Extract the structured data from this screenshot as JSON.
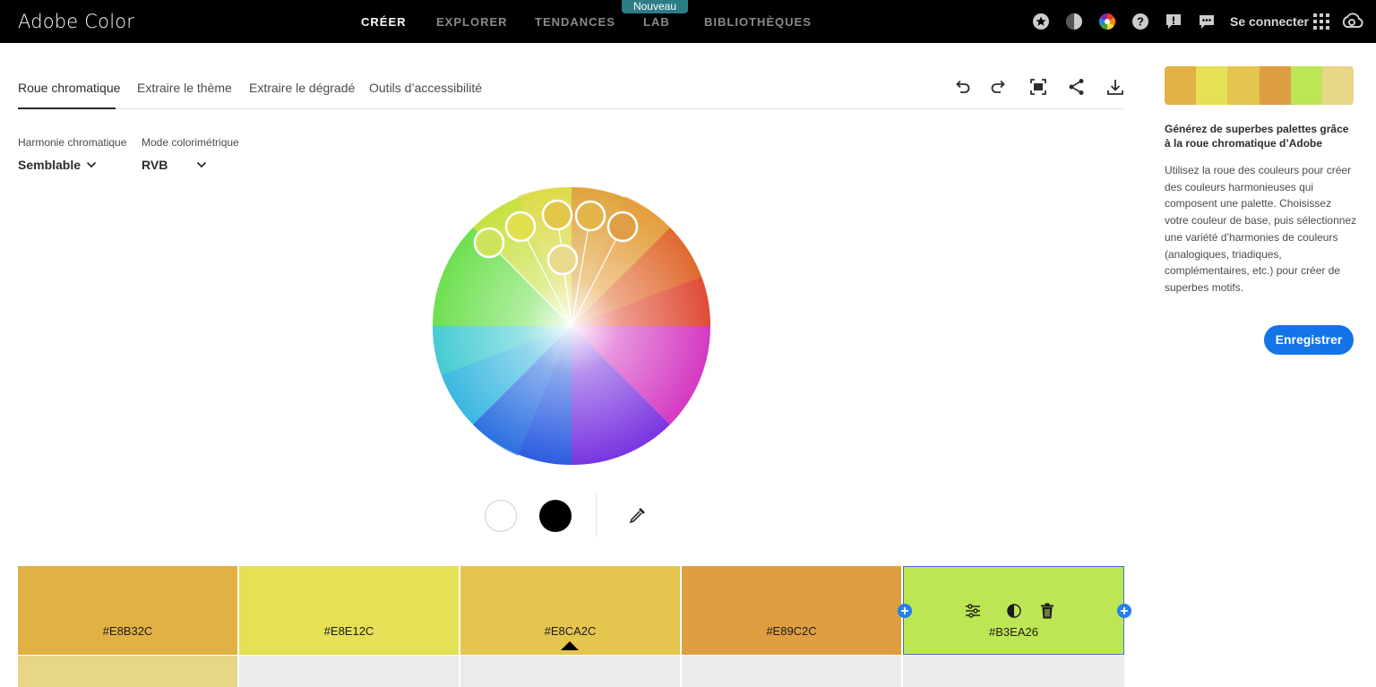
{
  "app": {
    "title": "Adobe Color"
  },
  "topnav": {
    "items": [
      {
        "label": "CRÉER",
        "active": true
      },
      {
        "label": "EXPLORER",
        "active": false
      },
      {
        "label": "TENDANCES",
        "active": false
      },
      {
        "label": "LAB",
        "active": false
      },
      {
        "label": "BIBLIOTHÈQUES",
        "active": false
      }
    ],
    "lab_badge": "Nouveau",
    "signin": "Se connecter",
    "icons": [
      "star-icon",
      "contrast-icon",
      "color-wheel-icon",
      "help-icon",
      "feedback-icon",
      "chat-icon",
      "apps-grid-icon",
      "creative-cloud-icon"
    ]
  },
  "tabs": [
    {
      "label": "Roue chromatique",
      "active": true
    },
    {
      "label": "Extraire le thème",
      "active": false
    },
    {
      "label": "Extraire le dégradé",
      "active": false
    },
    {
      "label": "Outils d’accessibilité",
      "active": false
    }
  ],
  "toolbar_icons": [
    "undo-icon",
    "redo-icon",
    "fullscreen-icon",
    "share-icon",
    "download-icon"
  ],
  "controls": {
    "harmony_label": "Harmonie chromatique",
    "harmony_value": "Semblable",
    "mode_label": "Mode colorimétrique",
    "mode_value": "RVB"
  },
  "palette": {
    "colors": [
      {
        "hex": "#E8B32C",
        "display": "#E8B32C"
      },
      {
        "hex": "#E8E12C",
        "display": "#E8E12C"
      },
      {
        "hex": "#E8CA2C",
        "display": "#E8CA2C",
        "base": true
      },
      {
        "hex": "#E89C2C",
        "display": "#E89C2C"
      },
      {
        "hex": "#B3EA26",
        "display": "#B3EA26",
        "selected": true
      }
    ],
    "swatch_fill": [
      "#e2b145",
      "#e5e055",
      "#e4c54e",
      "#e09e43",
      "#bde654",
      "#e8d689"
    ],
    "second_row_first": "#e7d688"
  },
  "sidebar": {
    "title": "Générez de superbes palettes grâce à la roue chromatique d’Adobe",
    "body": "Utilisez la roue des couleurs pour créer des couleurs harmonieuses qui composent une palette. Choisissez votre couleur de base, puis sélectionnez une variété d’harmonies de couleurs (analogiques, triadiques, complémentaires, etc.) pour créer de superbes motifs.",
    "save_label": "Enregistrer"
  }
}
